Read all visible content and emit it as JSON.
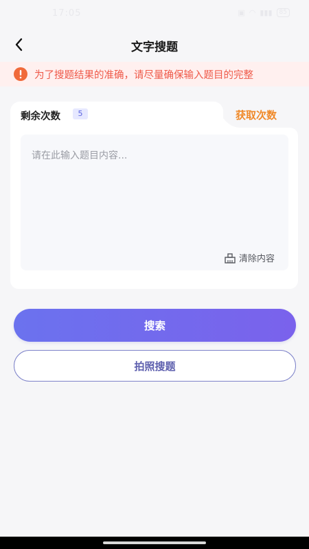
{
  "status_bar": {
    "time": "17:05",
    "icons": [
      "picture-icon",
      "wifi-icon",
      "signal-icon"
    ],
    "battery": "85"
  },
  "nav": {
    "title": "文字搜题"
  },
  "notice": {
    "text": "为了搜题结果的准确，请尽量确保输入题目的完整",
    "color": "#ef5a4a"
  },
  "card": {
    "remaining_label": "剩余次数",
    "remaining_count": "5",
    "get_more_label": "获取次数",
    "input": {
      "value": "",
      "placeholder": "请在此输入题目内容..."
    },
    "clear_label": "清除内容"
  },
  "buttons": {
    "search_label": "搜索",
    "photo_search_label": "拍照搜题"
  },
  "colors": {
    "accent": "#6b72ee",
    "orange": "#f08a2a"
  }
}
